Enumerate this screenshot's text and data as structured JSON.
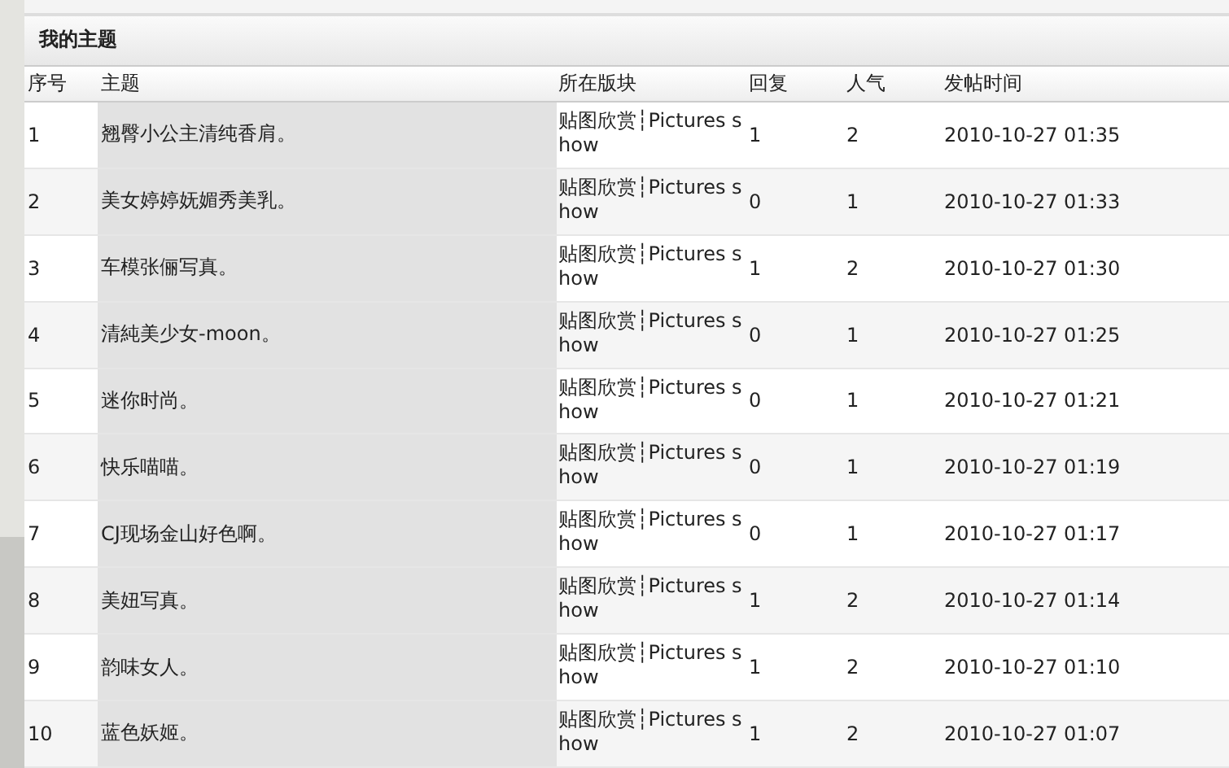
{
  "panel": {
    "title": "我的主题"
  },
  "table": {
    "columns": [
      "序号",
      "主题",
      "所在版块",
      "回复",
      "人气",
      "发帖时间"
    ],
    "rows": [
      [
        "1",
        "翘臀小公主清纯香肩。",
        "贴图欣赏┆Pictures show",
        "1",
        "2",
        "2010-10-27 01:35"
      ],
      [
        "2",
        "美女婷婷妩媚秀美乳。",
        "贴图欣赏┆Pictures show",
        "0",
        "1",
        "2010-10-27 01:33"
      ],
      [
        "3",
        "车模张俪写真。",
        "贴图欣赏┆Pictures show",
        "1",
        "2",
        "2010-10-27 01:30"
      ],
      [
        "4",
        "清純美少女-moon。",
        "贴图欣赏┆Pictures show",
        "0",
        "1",
        "2010-10-27 01:25"
      ],
      [
        "5",
        "迷你时尚。",
        "贴图欣赏┆Pictures show",
        "0",
        "1",
        "2010-10-27 01:21"
      ],
      [
        "6",
        "快乐喵喵。",
        "贴图欣赏┆Pictures show",
        "0",
        "1",
        "2010-10-27 01:19"
      ],
      [
        "7",
        "CJ现场金山好色啊。",
        "贴图欣赏┆Pictures show",
        "0",
        "1",
        "2010-10-27 01:17"
      ],
      [
        "8",
        "美妞写真。",
        "贴图欣赏┆Pictures show",
        "1",
        "2",
        "2010-10-27 01:14"
      ],
      [
        "9",
        "韵味女人。",
        "贴图欣赏┆Pictures show",
        "1",
        "2",
        "2010-10-27 01:10"
      ],
      [
        "10",
        "蓝色妖姬。",
        "贴图欣赏┆Pictures show",
        "1",
        "2",
        "2010-10-27 01:07"
      ]
    ]
  }
}
